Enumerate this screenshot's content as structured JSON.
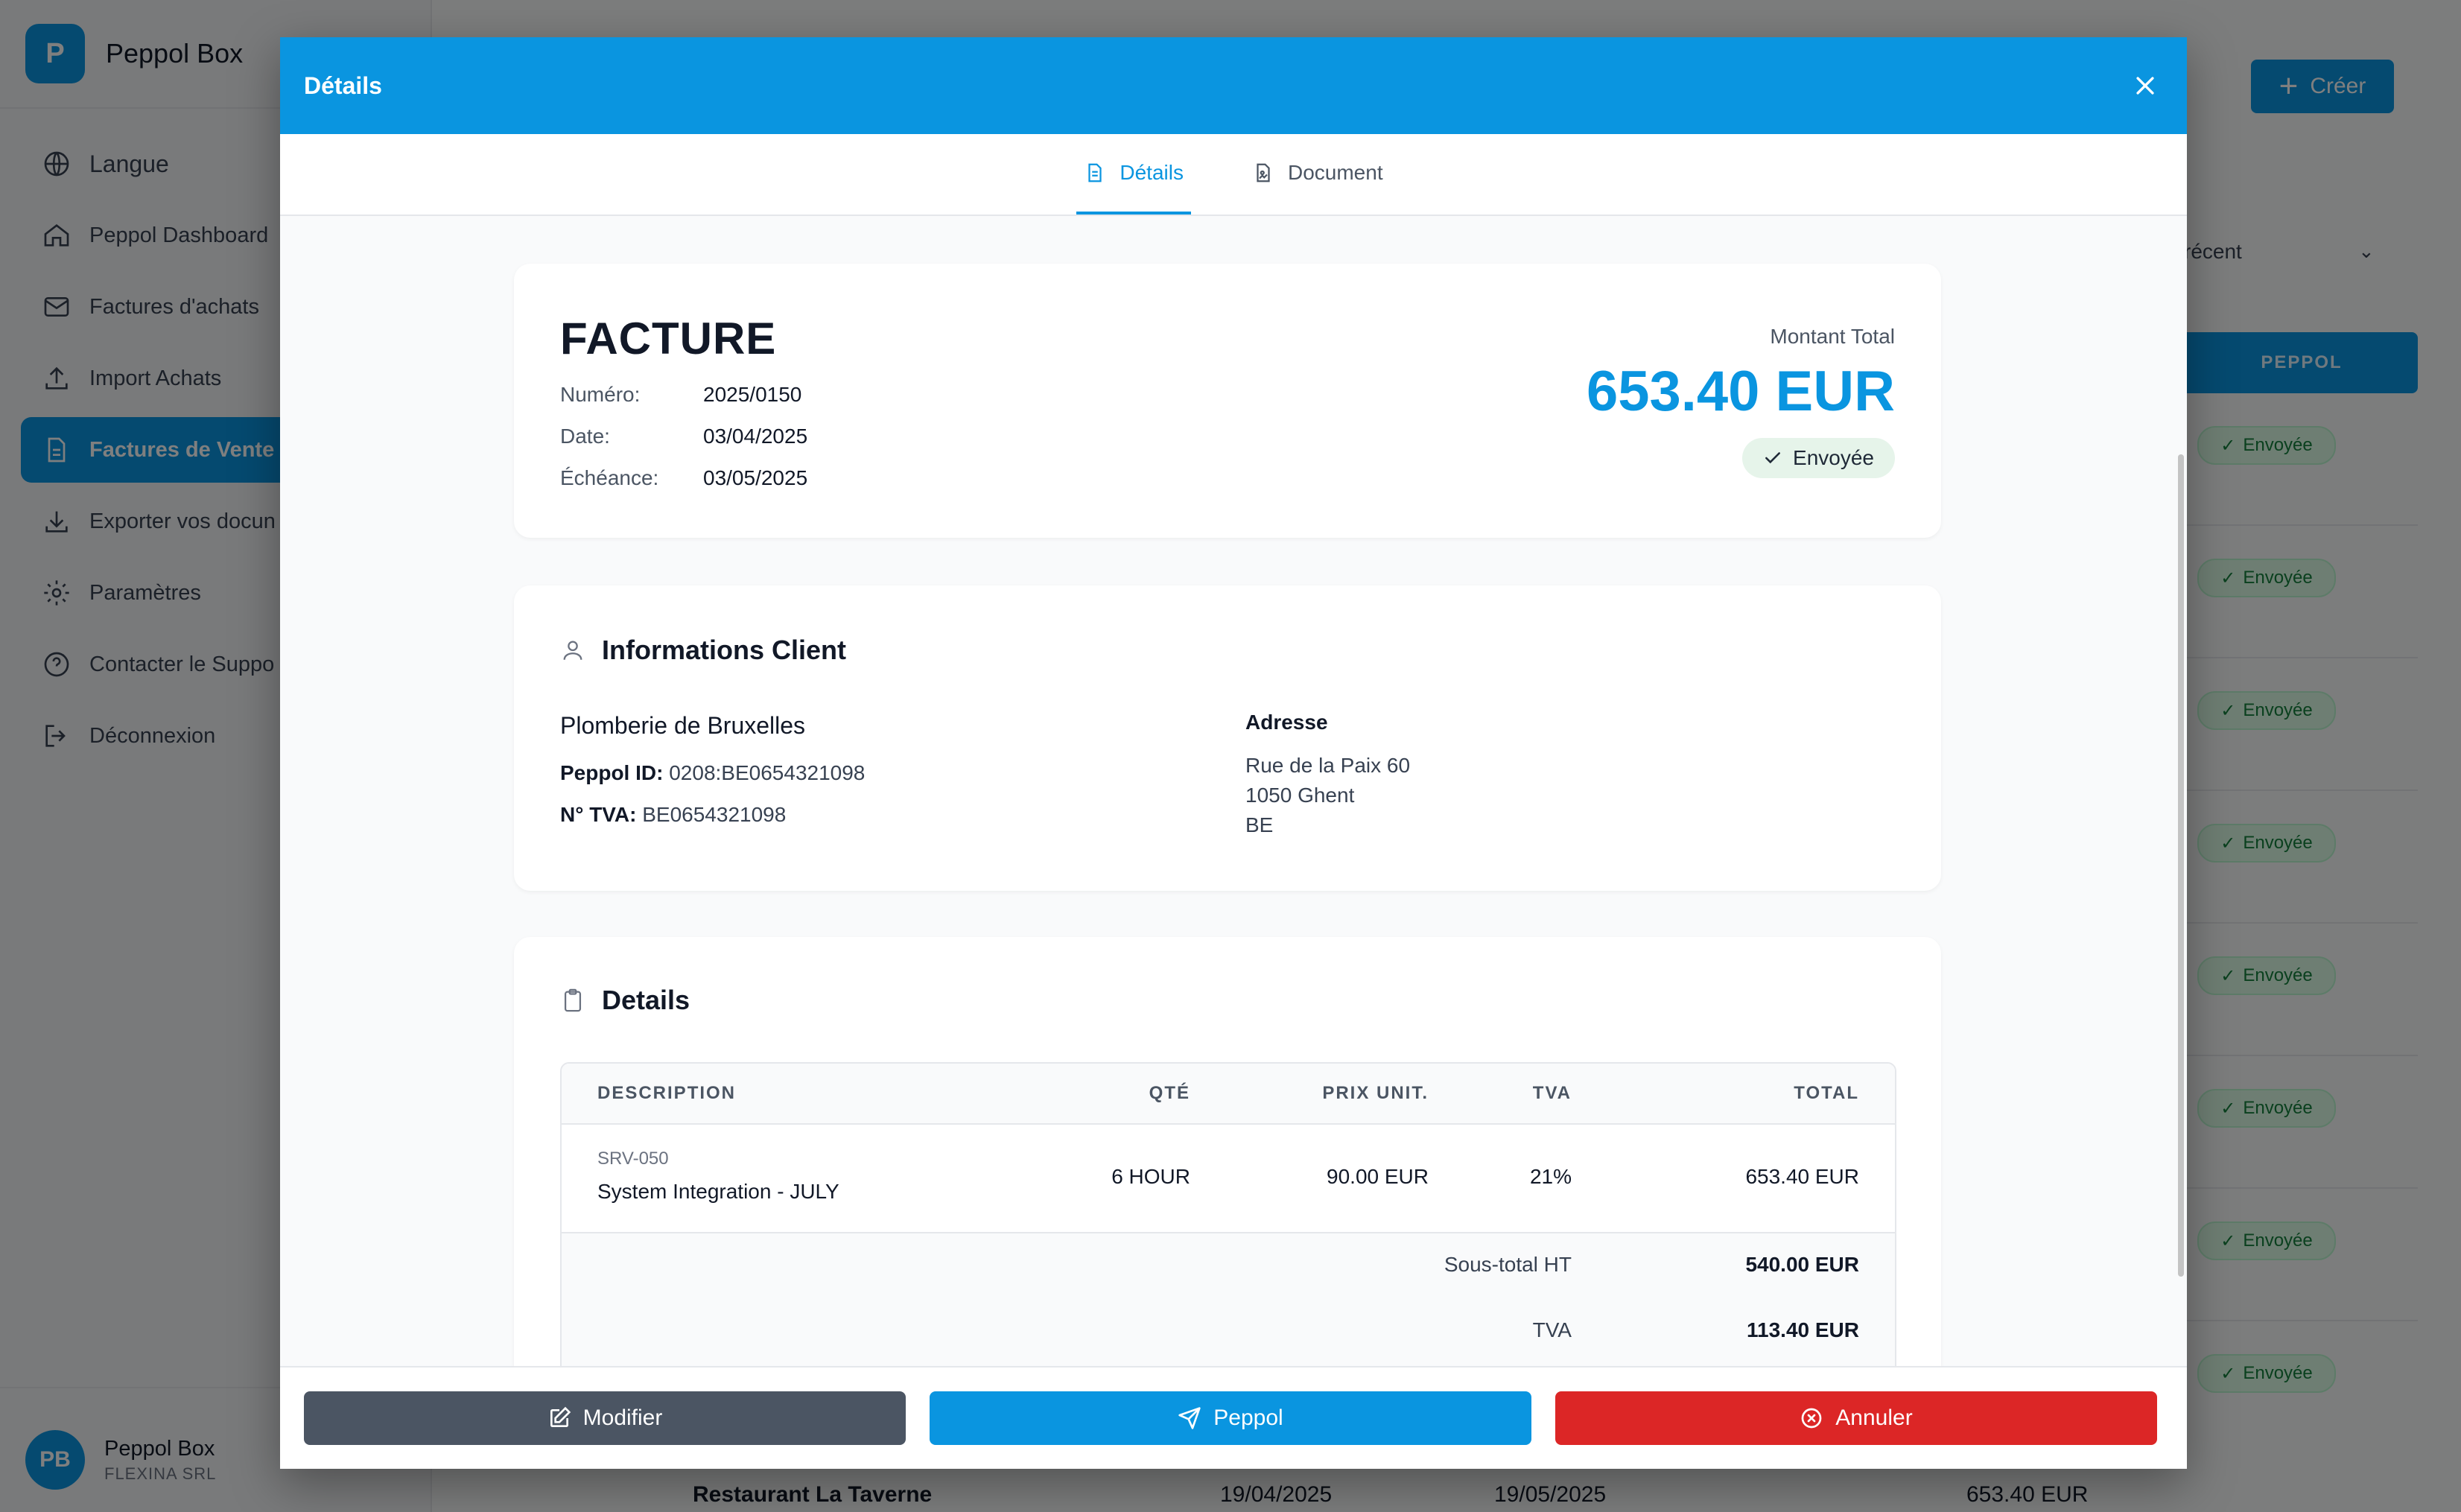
{
  "app": {
    "brand_letter": "P",
    "brand_name": "Peppol Box",
    "nav": [
      {
        "label": "Langue",
        "icon": "globe-icon"
      },
      {
        "label": "Peppol Dashboard",
        "icon": "home-icon"
      },
      {
        "label": "Factures d'achats",
        "icon": "mail-icon"
      },
      {
        "label": "Import Achats",
        "icon": "upload-icon"
      },
      {
        "label": "Factures de Vente",
        "icon": "document-icon",
        "active": true
      },
      {
        "label": "Exporter vos docun",
        "icon": "download-icon"
      },
      {
        "label": "Paramètres",
        "icon": "gear-icon"
      },
      {
        "label": "Contacter le Suppo",
        "icon": "help-icon"
      },
      {
        "label": "Déconnexion",
        "icon": "logout-icon"
      }
    ],
    "user": {
      "initials": "PB",
      "name": "Peppol Box",
      "company": "FLEXINA SRL"
    },
    "create_label": "Créer",
    "sort_value": "récent",
    "column_header": "PEPPOL",
    "row_status": "Envoyée",
    "bottom_row": {
      "name": "Restaurant La Taverne",
      "date": "19/04/2025",
      "due": "19/05/2025",
      "amount": "653.40 EUR"
    }
  },
  "modal": {
    "title": "Détails",
    "tabs": [
      {
        "label": "Détails",
        "active": true
      },
      {
        "label": "Document",
        "active": false
      }
    ],
    "invoice": {
      "heading": "FACTURE",
      "number_label": "Numéro:",
      "number": "2025/0150",
      "date_label": "Date:",
      "date": "03/04/2025",
      "due_label": "Échéance:",
      "due": "03/05/2025",
      "total_label": "Montant Total",
      "total": "653.40 EUR",
      "status": "Envoyée"
    },
    "client": {
      "section_title": "Informations Client",
      "name": "Plomberie de Bruxelles",
      "peppol_label": "Peppol ID:",
      "peppol_id": "0208:BE0654321098",
      "vat_label": "N° TVA:",
      "vat": "BE0654321098",
      "address_label": "Adresse",
      "address_line1": "Rue de la Paix 60",
      "address_line2": "1050 Ghent",
      "address_line3": "BE"
    },
    "details": {
      "section_title": "Details",
      "columns": {
        "description": "DESCRIPTION",
        "qty": "QTÉ",
        "unit_price": "PRIX UNIT.",
        "vat": "TVA",
        "total": "TOTAL"
      },
      "line": {
        "sku": "SRV-050",
        "description": "System Integration - JULY",
        "qty": "6 HOUR",
        "unit_price": "90.00 EUR",
        "vat": "21%",
        "total": "653.40 EUR"
      },
      "subtotal_label": "Sous-total HT",
      "subtotal": "540.00 EUR",
      "vat_label": "TVA",
      "vat_amount": "113.40 EUR"
    },
    "actions": {
      "edit": "Modifier",
      "peppol": "Peppol",
      "cancel": "Annuler"
    }
  },
  "colors": {
    "primary": "#0a95e0",
    "danger": "#dc2626",
    "neutral": "#4b5563",
    "success_bg": "#dcfce7"
  }
}
